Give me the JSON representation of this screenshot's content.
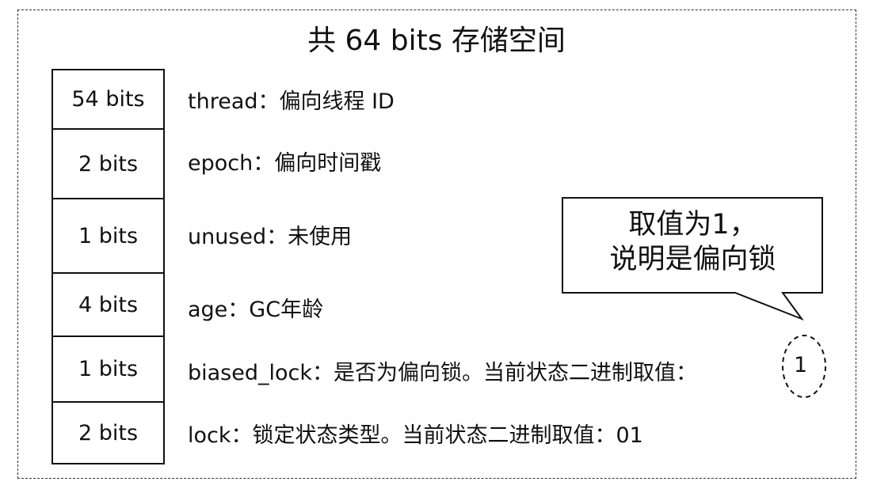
{
  "title": "共 64 bits 存储空间",
  "rows": [
    {
      "bits": "54 bits",
      "desc": "thread：偏向线程 ID"
    },
    {
      "bits": "2 bits",
      "desc": "epoch：偏向时间戳"
    },
    {
      "bits": "1 bits",
      "desc": "unused：未使用"
    },
    {
      "bits": "4 bits",
      "desc": "age：GC年龄"
    },
    {
      "bits": "1 bits",
      "desc": "biased_lock：是否为偏向锁。当前状态二进制取值："
    },
    {
      "bits": "2 bits",
      "desc": "lock：锁定状态类型。当前状态二进制取值：01"
    }
  ],
  "highlight_value": "1",
  "callout": {
    "line1": "取值为1，",
    "line2": "说明是偏向锁"
  }
}
